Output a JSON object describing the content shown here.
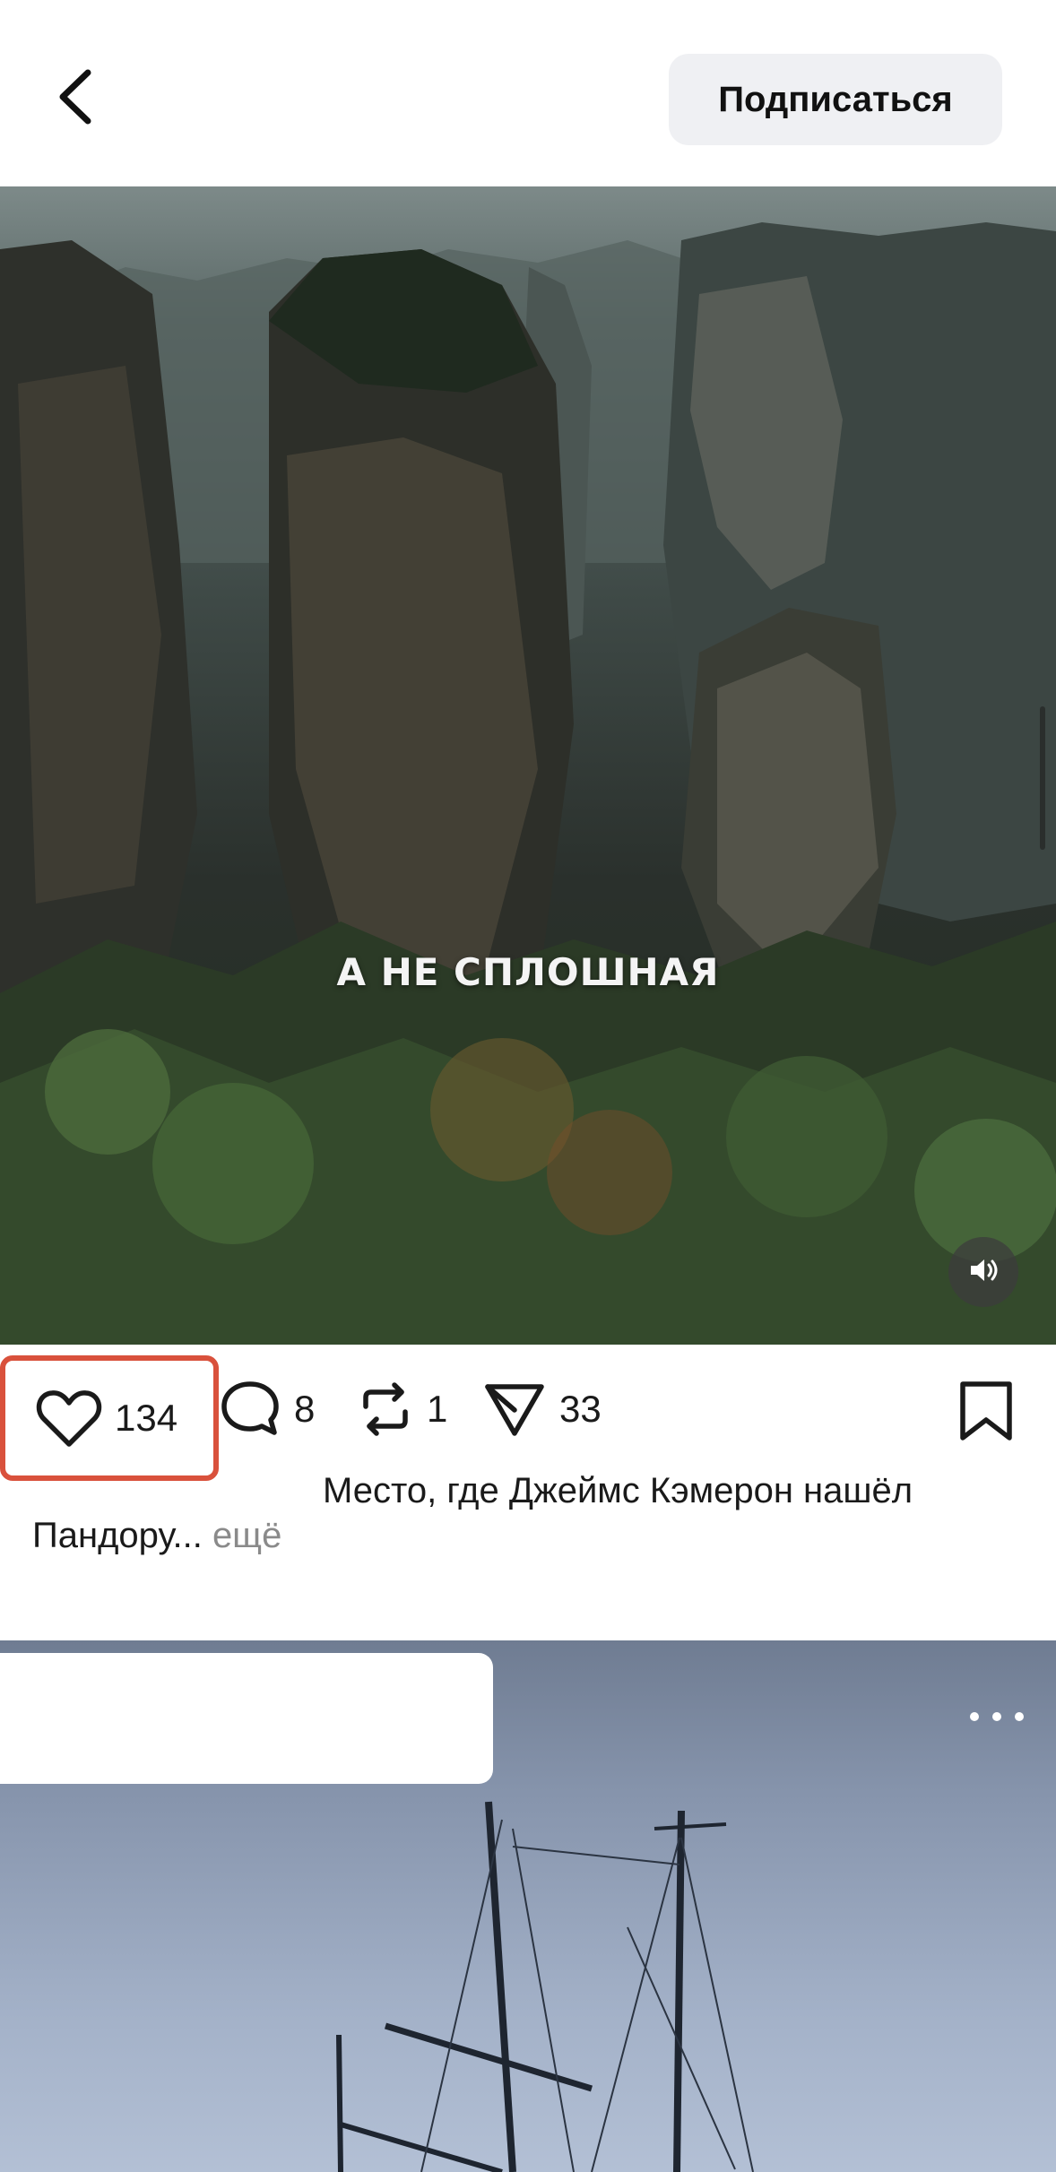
{
  "header": {
    "back_icon": "chevron-left-icon",
    "subscribe_label": "Подписаться"
  },
  "video": {
    "overlay_text": "А НЕ СПЛОШНАЯ",
    "sound_icon": "speaker-icon"
  },
  "actions": {
    "likes": "134",
    "comments": "8",
    "reposts": "1",
    "shares": "33",
    "like_icon": "heart-icon",
    "comment_icon": "comment-bubble-icon",
    "repost_icon": "repost-icon",
    "share_icon": "share-arrow-icon",
    "bookmark_icon": "bookmark-icon",
    "highlight_color": "#d9513c"
  },
  "caption": {
    "line1": "Место, где Джеймс Кэмерон нашёл",
    "line2": "Пандору...",
    "more": "ещё"
  },
  "next_post": {
    "menu_icon": "more-dots-icon"
  }
}
